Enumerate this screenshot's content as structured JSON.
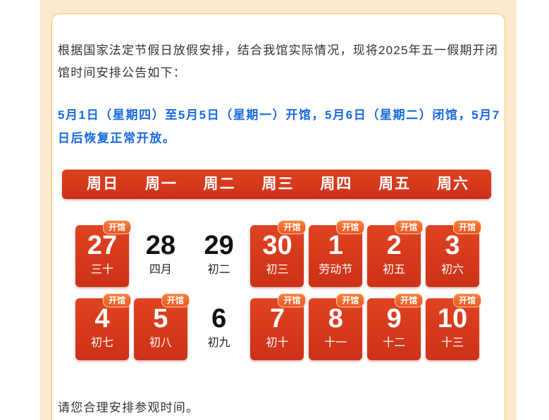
{
  "intro_lines": [
    "根据国家法定节假日放假安排，结合我馆实际情况，现将2025年五一假期开闭",
    "馆时间安排公告如下："
  ],
  "notice_lines": [
    "5月1日（星期四）至5月5日（星期一）开馆，5月6日（星期二）闭馆，5月7",
    "日后恢复正常开放。"
  ],
  "calendar": {
    "weekdays": [
      "周日",
      "周一",
      "周二",
      "周三",
      "周四",
      "周五",
      "周六"
    ],
    "open_badge": "开馆",
    "weeks": [
      [
        {
          "day": "27",
          "lunar": "三十",
          "open": true
        },
        {
          "day": "28",
          "lunar": "四月",
          "open": false
        },
        {
          "day": "29",
          "lunar": "初二",
          "open": false
        },
        {
          "day": "30",
          "lunar": "初三",
          "open": true
        },
        {
          "day": "1",
          "lunar": "劳动节",
          "open": true
        },
        {
          "day": "2",
          "lunar": "初五",
          "open": true
        },
        {
          "day": "3",
          "lunar": "初六",
          "open": true
        }
      ],
      [
        {
          "day": "4",
          "lunar": "初七",
          "open": true
        },
        {
          "day": "5",
          "lunar": "初八",
          "open": true
        },
        {
          "day": "6",
          "lunar": "初九",
          "open": false
        },
        {
          "day": "7",
          "lunar": "初十",
          "open": true
        },
        {
          "day": "8",
          "lunar": "十一",
          "open": true
        },
        {
          "day": "9",
          "lunar": "十二",
          "open": true
        },
        {
          "day": "10",
          "lunar": "十三",
          "open": true
        }
      ]
    ]
  },
  "footer": "请您合理安排参观时间。",
  "colors": {
    "page_band": "#fde9cf",
    "card_border": "#f3c94a",
    "notice_blue": "#1769e0",
    "calendar_red": "#d63a1c",
    "badge_orange": "#f06a2e"
  }
}
